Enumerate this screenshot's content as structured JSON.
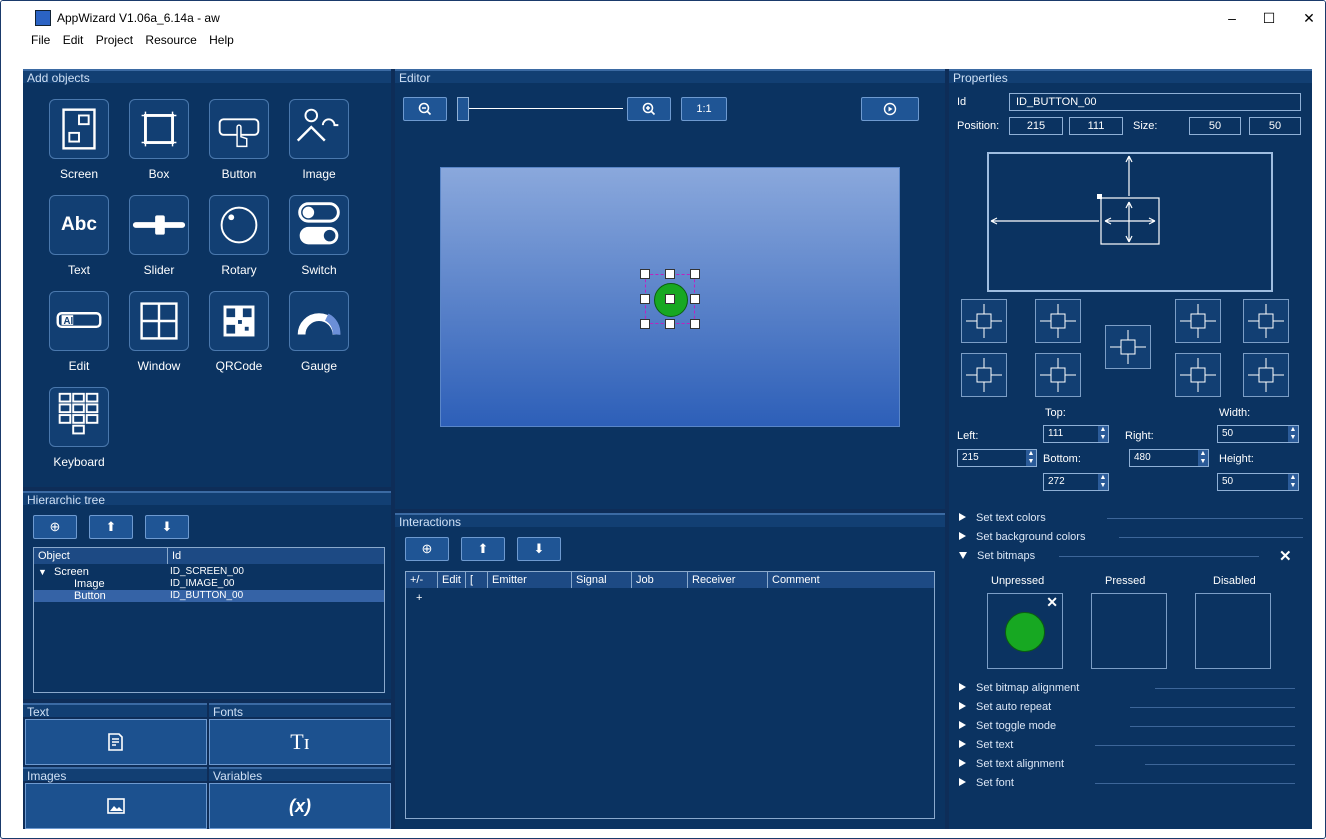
{
  "window": {
    "title": "AppWizard V1.06a_6.14a - aw",
    "minimize": "–",
    "maximize": "☐",
    "close": "✕"
  },
  "menu": [
    {
      "label": "File"
    },
    {
      "label": "Edit"
    },
    {
      "label": "Project"
    },
    {
      "label": "Resource"
    },
    {
      "label": "Help"
    }
  ],
  "add_objects": {
    "heading": "Add objects",
    "items": [
      {
        "label": "Screen",
        "icon": "screen-icon"
      },
      {
        "label": "Box",
        "icon": "box-icon"
      },
      {
        "label": "Button",
        "icon": "button-icon"
      },
      {
        "label": "Image",
        "icon": "image-icon"
      },
      {
        "label": "Text",
        "icon": "text-icon",
        "glyph": "Abc"
      },
      {
        "label": "Slider",
        "icon": "slider-icon"
      },
      {
        "label": "Rotary",
        "icon": "rotary-icon"
      },
      {
        "label": "Switch",
        "icon": "switch-icon"
      },
      {
        "label": "Edit",
        "icon": "edit-icon",
        "glyph": "AI"
      },
      {
        "label": "Window",
        "icon": "window-icon"
      },
      {
        "label": "QRCode",
        "icon": "qrcode-icon"
      },
      {
        "label": "Gauge",
        "icon": "gauge-icon"
      },
      {
        "label": "Keyboard",
        "icon": "keyboard-icon"
      }
    ]
  },
  "hierarchic_tree": {
    "heading": "Hierarchic tree",
    "columns": [
      "Object",
      "Id"
    ],
    "rows": [
      {
        "object": "Screen",
        "id": "ID_SCREEN_00"
      },
      {
        "object": "Image",
        "id": "ID_IMAGE_00"
      },
      {
        "object": "Button",
        "id": "ID_BUTTON_00"
      }
    ]
  },
  "resources": {
    "text": "Text",
    "fonts": "Fonts",
    "fonts_glyph": "Tɪ",
    "images": "Images",
    "variables": "Variables",
    "variables_glyph": "(x)"
  },
  "editor": {
    "heading": "Editor",
    "zoom_reset": "1:1",
    "zoom_level": 0
  },
  "interactions": {
    "heading": "Interactions",
    "columns": [
      "+/-",
      "Edit",
      "[",
      "Emitter",
      "Signal",
      "Job",
      "Receiver",
      "Comment"
    ],
    "add_row": "+"
  },
  "properties": {
    "heading": "Properties",
    "id_label": "Id",
    "id_value": "ID_BUTTON_00",
    "position_label": "Position:",
    "pos_x": "215",
    "pos_y": "111",
    "size_label": "Size:",
    "size_w": "50",
    "size_h": "50",
    "top_label": "Top:",
    "width_label": "Width:",
    "left_label": "Left:",
    "right_label": "Right:",
    "bottom_label": "Bottom:",
    "height_label": "Height:",
    "top_value": "111",
    "width_value": "50",
    "left_value": "215",
    "right_value": "480",
    "bottom_value": "272",
    "height_value": "50",
    "sections_top": [
      "Set text colors",
      "Set background colors"
    ],
    "bitmaps_section": "Set bitmaps",
    "bitmaps_close": "✕",
    "bitmap_states": [
      "Unpressed",
      "Pressed",
      "Disabled"
    ],
    "bitmap_remove": "✕",
    "sections_bottom": [
      "Set bitmap alignment",
      "Set auto repeat",
      "Set toggle mode",
      "Set text",
      "Set text alignment",
      "Set font"
    ]
  },
  "colors": {
    "panel": "#0b3361",
    "canvas_top": "#8aa8dc",
    "canvas_bottom": "#2d5fb8",
    "button_green": "#17a822",
    "selection": "#c020c0"
  }
}
